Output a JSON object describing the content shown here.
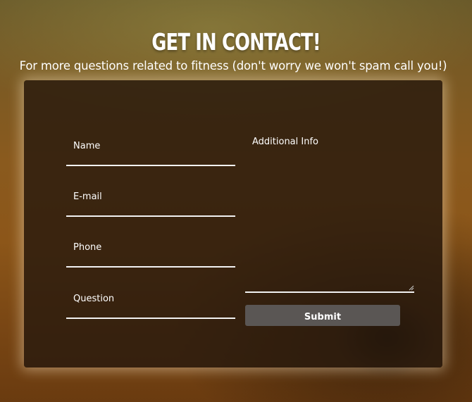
{
  "header": {
    "title": "GET IN CONTACT!",
    "subtitle": "For more questions related to fitness (don't worry we won't spam call you!)"
  },
  "form": {
    "fields": [
      {
        "label": "Name",
        "value": ""
      },
      {
        "label": "E-mail",
        "value": ""
      },
      {
        "label": "Phone",
        "value": ""
      },
      {
        "label": "Question",
        "value": ""
      }
    ],
    "additional_info_label": "Additional Info",
    "submit_label": "Submit"
  },
  "colors": {
    "panel": "#281a0e",
    "underline": "#f2f2f2",
    "button": "#5a5654",
    "text": "#ffffff"
  }
}
